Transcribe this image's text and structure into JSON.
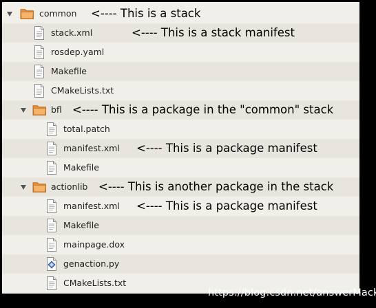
{
  "tree": {
    "common": {
      "label": "common",
      "note": "<---- This is a stack"
    },
    "stack_xml": {
      "label": "stack.xml",
      "note": "<---- This is a stack manifest"
    },
    "rosdep_yaml": {
      "label": "rosdep.yaml"
    },
    "makefile_1": {
      "label": "Makefile"
    },
    "cmakelists_1": {
      "label": "CMakeLists.txt"
    },
    "bfl": {
      "label": "bfl",
      "note": "<---- This is a package in the \"common\" stack"
    },
    "total_patch": {
      "label": "total.patch"
    },
    "bfl_manifest": {
      "label": "manifest.xml",
      "note": "<---- This is a package manifest"
    },
    "makefile_2": {
      "label": "Makefile"
    },
    "actionlib": {
      "label": "actionlib",
      "note": "<---- This is another package in the stack"
    },
    "actionlib_manifest": {
      "label": "manifest.xml",
      "note": "<---- This is a package manifest"
    },
    "makefile_3": {
      "label": "Makefile"
    },
    "mainpage_dox": {
      "label": "mainpage.dox"
    },
    "genaction_py": {
      "label": "genaction.py"
    },
    "cmakelists_2": {
      "label": "CMakeLists.txt"
    }
  },
  "icons": {
    "folder": "folder-open-icon",
    "file": "text-file-icon",
    "script": "python-script-icon",
    "expander": "expander-down-icon"
  },
  "colors": {
    "row_light": "#f1efea",
    "row_dark": "#e8e5de",
    "folder": "#f0a254"
  },
  "watermark": "https://blog.csdn.net/answerMack"
}
